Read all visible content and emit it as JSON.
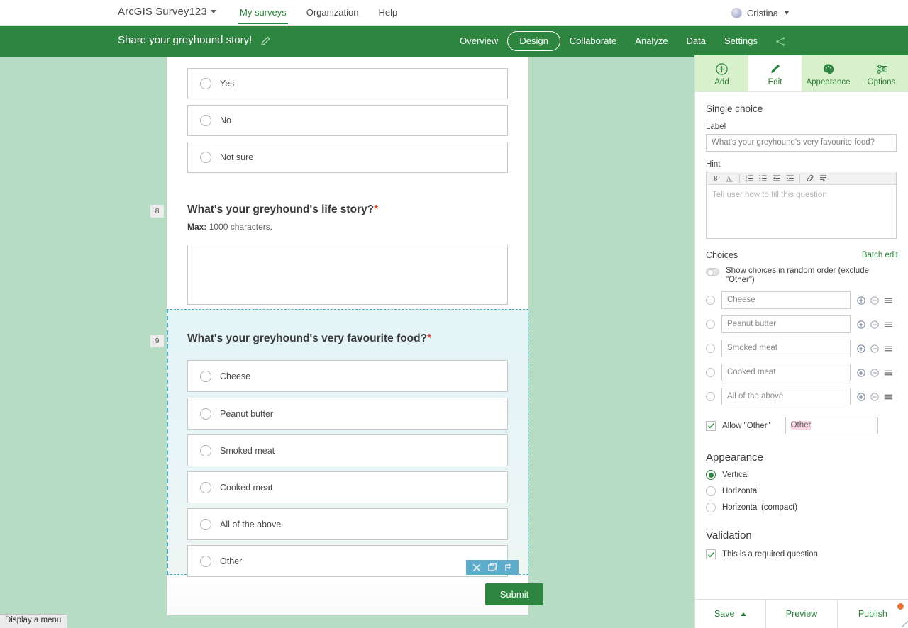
{
  "topbar": {
    "brand": "ArcGIS Survey123",
    "nav": [
      {
        "label": "My surveys",
        "active": true
      },
      {
        "label": "Organization",
        "active": false
      },
      {
        "label": "Help",
        "active": false
      }
    ],
    "user_name": "Cristina"
  },
  "surveybar": {
    "title": "Share your greyhound story!",
    "edit_icon": "pencil-icon",
    "tabs": [
      {
        "label": "Overview",
        "active": false
      },
      {
        "label": "Design",
        "active": true
      },
      {
        "label": "Collaborate",
        "active": false
      },
      {
        "label": "Analyze",
        "active": false
      },
      {
        "label": "Data",
        "active": false
      },
      {
        "label": "Settings",
        "active": false
      }
    ],
    "share_icon": "share-icon"
  },
  "form": {
    "question7": {
      "options": [
        "Yes",
        "No",
        "Not sure"
      ]
    },
    "question8": {
      "number": "8",
      "title": "What's your greyhound's life story?",
      "required_marker": "*",
      "max_prefix": "Max:",
      "max_text": "1000 characters."
    },
    "question9": {
      "number": "9",
      "title": "What's your greyhound's very favourite food?",
      "required_marker": "*",
      "options": [
        "Cheese",
        "Peanut butter",
        "Smoked meat",
        "Cooked meat",
        "All of the above",
        "Other"
      ],
      "toolbar_icons": [
        "close-icon",
        "duplicate-icon",
        "rule-icon"
      ]
    },
    "submit_label": "Submit"
  },
  "status_tip": "Display a menu",
  "panel": {
    "tabs": [
      {
        "label": "Add",
        "icon": "plus-circle-icon",
        "active": false
      },
      {
        "label": "Edit",
        "icon": "pencil-icon",
        "active": true
      },
      {
        "label": "Appearance",
        "icon": "palette-icon",
        "active": false
      },
      {
        "label": "Options",
        "icon": "sliders-icon",
        "active": false
      }
    ],
    "type_title": "Single choice",
    "label_field": {
      "label": "Label",
      "value": "What's your greyhound's very favourite food?"
    },
    "hint_field": {
      "label": "Hint",
      "placeholder": "Tell user how to fill this question",
      "toolbar": [
        "bold-icon",
        "font-color-icon",
        "ordered-list-icon",
        "unordered-list-icon",
        "outdent-icon",
        "indent-icon",
        "link-icon",
        "insert-icon"
      ]
    },
    "choices": {
      "heading": "Choices",
      "batch_edit": "Batch edit",
      "random_order_label": "Show choices in random order (exclude \"Other\")",
      "random_order_on": false,
      "items": [
        "Cheese",
        "Peanut butter",
        "Smoked meat",
        "Cooked meat",
        "All of the above"
      ],
      "row_icons": [
        "add-circle-icon",
        "remove-circle-icon",
        "drag-handle-icon"
      ],
      "allow_other_label": "Allow \"Other\"",
      "allow_other_checked": true,
      "other_value": "Other"
    },
    "appearance": {
      "heading": "Appearance",
      "options": [
        {
          "label": "Vertical",
          "selected": true
        },
        {
          "label": "Horizontal",
          "selected": false
        },
        {
          "label": "Horizontal (compact)",
          "selected": false
        }
      ]
    },
    "validation": {
      "heading": "Validation",
      "required_label": "This is a required question",
      "required_checked": true
    },
    "footer": {
      "save": "Save",
      "preview": "Preview",
      "publish": "Publish"
    }
  },
  "colors": {
    "brand_green": "#2e8540",
    "panel_tab_green": "#d9f0cd",
    "canvas_green": "#b6dcc4",
    "selection_blue": "#49a7cf",
    "toolbar_blue": "#5eadcd",
    "required_red": "#d9452b",
    "highlight_pink": "#fbd5e4",
    "publish_dot_orange": "#e8763a"
  }
}
